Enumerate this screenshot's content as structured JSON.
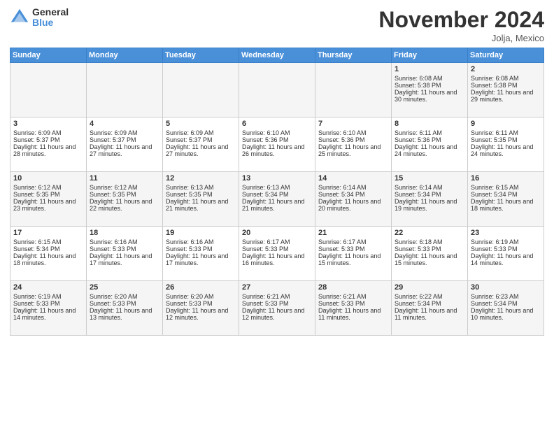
{
  "header": {
    "logo_general": "General",
    "logo_blue": "Blue",
    "title": "November 2024",
    "location": "Jolja, Mexico"
  },
  "days_of_week": [
    "Sunday",
    "Monday",
    "Tuesday",
    "Wednesday",
    "Thursday",
    "Friday",
    "Saturday"
  ],
  "weeks": [
    {
      "id": "week1",
      "days": [
        {
          "date": "",
          "empty": true
        },
        {
          "date": "",
          "empty": true
        },
        {
          "date": "",
          "empty": true
        },
        {
          "date": "",
          "empty": true
        },
        {
          "date": "",
          "empty": true
        },
        {
          "date": "1",
          "sunrise": "Sunrise: 6:08 AM",
          "sunset": "Sunset: 5:38 PM",
          "daylight": "Daylight: 11 hours and 30 minutes."
        },
        {
          "date": "2",
          "sunrise": "Sunrise: 6:08 AM",
          "sunset": "Sunset: 5:38 PM",
          "daylight": "Daylight: 11 hours and 29 minutes."
        }
      ]
    },
    {
      "id": "week2",
      "days": [
        {
          "date": "3",
          "sunrise": "Sunrise: 6:09 AM",
          "sunset": "Sunset: 5:37 PM",
          "daylight": "Daylight: 11 hours and 28 minutes."
        },
        {
          "date": "4",
          "sunrise": "Sunrise: 6:09 AM",
          "sunset": "Sunset: 5:37 PM",
          "daylight": "Daylight: 11 hours and 27 minutes."
        },
        {
          "date": "5",
          "sunrise": "Sunrise: 6:09 AM",
          "sunset": "Sunset: 5:37 PM",
          "daylight": "Daylight: 11 hours and 27 minutes."
        },
        {
          "date": "6",
          "sunrise": "Sunrise: 6:10 AM",
          "sunset": "Sunset: 5:36 PM",
          "daylight": "Daylight: 11 hours and 26 minutes."
        },
        {
          "date": "7",
          "sunrise": "Sunrise: 6:10 AM",
          "sunset": "Sunset: 5:36 PM",
          "daylight": "Daylight: 11 hours and 25 minutes."
        },
        {
          "date": "8",
          "sunrise": "Sunrise: 6:11 AM",
          "sunset": "Sunset: 5:36 PM",
          "daylight": "Daylight: 11 hours and 24 minutes."
        },
        {
          "date": "9",
          "sunrise": "Sunrise: 6:11 AM",
          "sunset": "Sunset: 5:35 PM",
          "daylight": "Daylight: 11 hours and 24 minutes."
        }
      ]
    },
    {
      "id": "week3",
      "days": [
        {
          "date": "10",
          "sunrise": "Sunrise: 6:12 AM",
          "sunset": "Sunset: 5:35 PM",
          "daylight": "Daylight: 11 hours and 23 minutes."
        },
        {
          "date": "11",
          "sunrise": "Sunrise: 6:12 AM",
          "sunset": "Sunset: 5:35 PM",
          "daylight": "Daylight: 11 hours and 22 minutes."
        },
        {
          "date": "12",
          "sunrise": "Sunrise: 6:13 AM",
          "sunset": "Sunset: 5:35 PM",
          "daylight": "Daylight: 11 hours and 21 minutes."
        },
        {
          "date": "13",
          "sunrise": "Sunrise: 6:13 AM",
          "sunset": "Sunset: 5:34 PM",
          "daylight": "Daylight: 11 hours and 21 minutes."
        },
        {
          "date": "14",
          "sunrise": "Sunrise: 6:14 AM",
          "sunset": "Sunset: 5:34 PM",
          "daylight": "Daylight: 11 hours and 20 minutes."
        },
        {
          "date": "15",
          "sunrise": "Sunrise: 6:14 AM",
          "sunset": "Sunset: 5:34 PM",
          "daylight": "Daylight: 11 hours and 19 minutes."
        },
        {
          "date": "16",
          "sunrise": "Sunrise: 6:15 AM",
          "sunset": "Sunset: 5:34 PM",
          "daylight": "Daylight: 11 hours and 18 minutes."
        }
      ]
    },
    {
      "id": "week4",
      "days": [
        {
          "date": "17",
          "sunrise": "Sunrise: 6:15 AM",
          "sunset": "Sunset: 5:34 PM",
          "daylight": "Daylight: 11 hours and 18 minutes."
        },
        {
          "date": "18",
          "sunrise": "Sunrise: 6:16 AM",
          "sunset": "Sunset: 5:33 PM",
          "daylight": "Daylight: 11 hours and 17 minutes."
        },
        {
          "date": "19",
          "sunrise": "Sunrise: 6:16 AM",
          "sunset": "Sunset: 5:33 PM",
          "daylight": "Daylight: 11 hours and 17 minutes."
        },
        {
          "date": "20",
          "sunrise": "Sunrise: 6:17 AM",
          "sunset": "Sunset: 5:33 PM",
          "daylight": "Daylight: 11 hours and 16 minutes."
        },
        {
          "date": "21",
          "sunrise": "Sunrise: 6:17 AM",
          "sunset": "Sunset: 5:33 PM",
          "daylight": "Daylight: 11 hours and 15 minutes."
        },
        {
          "date": "22",
          "sunrise": "Sunrise: 6:18 AM",
          "sunset": "Sunset: 5:33 PM",
          "daylight": "Daylight: 11 hours and 15 minutes."
        },
        {
          "date": "23",
          "sunrise": "Sunrise: 6:19 AM",
          "sunset": "Sunset: 5:33 PM",
          "daylight": "Daylight: 11 hours and 14 minutes."
        }
      ]
    },
    {
      "id": "week5",
      "days": [
        {
          "date": "24",
          "sunrise": "Sunrise: 6:19 AM",
          "sunset": "Sunset: 5:33 PM",
          "daylight": "Daylight: 11 hours and 14 minutes."
        },
        {
          "date": "25",
          "sunrise": "Sunrise: 6:20 AM",
          "sunset": "Sunset: 5:33 PM",
          "daylight": "Daylight: 11 hours and 13 minutes."
        },
        {
          "date": "26",
          "sunrise": "Sunrise: 6:20 AM",
          "sunset": "Sunset: 5:33 PM",
          "daylight": "Daylight: 11 hours and 12 minutes."
        },
        {
          "date": "27",
          "sunrise": "Sunrise: 6:21 AM",
          "sunset": "Sunset: 5:33 PM",
          "daylight": "Daylight: 11 hours and 12 minutes."
        },
        {
          "date": "28",
          "sunrise": "Sunrise: 6:21 AM",
          "sunset": "Sunset: 5:33 PM",
          "daylight": "Daylight: 11 hours and 11 minutes."
        },
        {
          "date": "29",
          "sunrise": "Sunrise: 6:22 AM",
          "sunset": "Sunset: 5:34 PM",
          "daylight": "Daylight: 11 hours and 11 minutes."
        },
        {
          "date": "30",
          "sunrise": "Sunrise: 6:23 AM",
          "sunset": "Sunset: 5:34 PM",
          "daylight": "Daylight: 11 hours and 10 minutes."
        }
      ]
    }
  ]
}
